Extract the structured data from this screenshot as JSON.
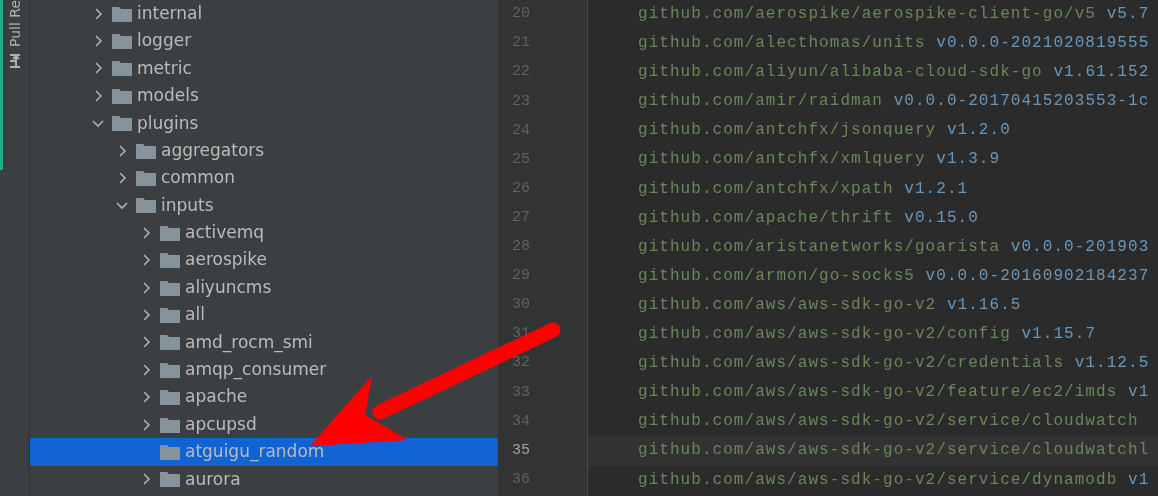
{
  "tool_strip": {
    "label": "Pull Re"
  },
  "tree": [
    {
      "name": "internal",
      "kind": "expandable",
      "expanded": false,
      "selected": false
    },
    {
      "name": "logger",
      "kind": "expandable",
      "expanded": false,
      "selected": false
    },
    {
      "name": "metric",
      "kind": "expandable",
      "expanded": false,
      "selected": false
    },
    {
      "name": "models",
      "kind": "expandable",
      "expanded": false,
      "selected": false
    },
    {
      "name": "plugins",
      "kind": "expandable",
      "expanded": true,
      "selected": false,
      "children": [
        {
          "name": "aggregators",
          "kind": "expandable",
          "expanded": false,
          "selected": false
        },
        {
          "name": "common",
          "kind": "expandable",
          "expanded": false,
          "selected": false
        },
        {
          "name": "inputs",
          "kind": "expandable",
          "expanded": true,
          "selected": false,
          "children": [
            {
              "name": "activemq",
              "kind": "expandable",
              "expanded": false,
              "selected": false
            },
            {
              "name": "aerospike",
              "kind": "expandable",
              "expanded": false,
              "selected": false
            },
            {
              "name": "aliyuncms",
              "kind": "expandable",
              "expanded": false,
              "selected": false
            },
            {
              "name": "all",
              "kind": "expandable",
              "expanded": false,
              "selected": false
            },
            {
              "name": "amd_rocm_smi",
              "kind": "expandable",
              "expanded": false,
              "selected": false
            },
            {
              "name": "amqp_consumer",
              "kind": "expandable",
              "expanded": false,
              "selected": false
            },
            {
              "name": "apache",
              "kind": "expandable",
              "expanded": false,
              "selected": false
            },
            {
              "name": "apcupsd",
              "kind": "expandable",
              "expanded": false,
              "selected": false
            },
            {
              "name": "atguigu_random",
              "kind": "leaf",
              "selected": true
            },
            {
              "name": "aurora",
              "kind": "expandable",
              "expanded": false,
              "selected": false
            }
          ]
        }
      ]
    }
  ],
  "editor": {
    "lines": [
      {
        "number": "20",
        "path": "github.com/aerospike/aerospike-client-go/v5",
        "version": "v5.7",
        "current": false
      },
      {
        "number": "21",
        "path": "github.com/alecthomas/units",
        "version": "v0.0.0-2021020819555",
        "current": false
      },
      {
        "number": "22",
        "path": "github.com/aliyun/alibaba-cloud-sdk-go",
        "version": "v1.61.152",
        "current": false
      },
      {
        "number": "23",
        "path": "github.com/amir/raidman",
        "version": "v0.0.0-20170415203553-1c",
        "current": false
      },
      {
        "number": "24",
        "path": "github.com/antchfx/jsonquery",
        "version": "v1.2.0",
        "current": false
      },
      {
        "number": "25",
        "path": "github.com/antchfx/xmlquery",
        "version": "v1.3.9",
        "current": false
      },
      {
        "number": "26",
        "path": "github.com/antchfx/xpath",
        "version": "v1.2.1",
        "current": false
      },
      {
        "number": "27",
        "path": "github.com/apache/thrift",
        "version": "v0.15.0",
        "current": false
      },
      {
        "number": "28",
        "path": "github.com/aristanetworks/goarista",
        "version": "v0.0.0-201903",
        "current": false
      },
      {
        "number": "29",
        "path": "github.com/armon/go-socks5",
        "version": "v0.0.0-20160902184237",
        "current": false
      },
      {
        "number": "30",
        "path": "github.com/aws/aws-sdk-go-v2",
        "version": "v1.16.5",
        "current": false
      },
      {
        "number": "31",
        "path": "github.com/aws/aws-sdk-go-v2/config",
        "version": "v1.15.7",
        "current": false
      },
      {
        "number": "32",
        "path": "github.com/aws/aws-sdk-go-v2/credentials",
        "version": "v1.12.5",
        "current": false
      },
      {
        "number": "33",
        "path": "github.com/aws/aws-sdk-go-v2/feature/ec2/imds",
        "version": "v1",
        "current": false
      },
      {
        "number": "34",
        "path": "github.com/aws/aws-sdk-go-v2/service/cloudwatch",
        "current": false
      },
      {
        "number": "35",
        "path": "github.com/aws/aws-sdk-go-v2/service/cloudwatchl",
        "current": true
      },
      {
        "number": "36",
        "path": "github.com/aws/aws-sdk-go-v2/service/dynamodb",
        "version": "v1",
        "current": false
      }
    ]
  },
  "annotation": {
    "kind": "arrow"
  }
}
